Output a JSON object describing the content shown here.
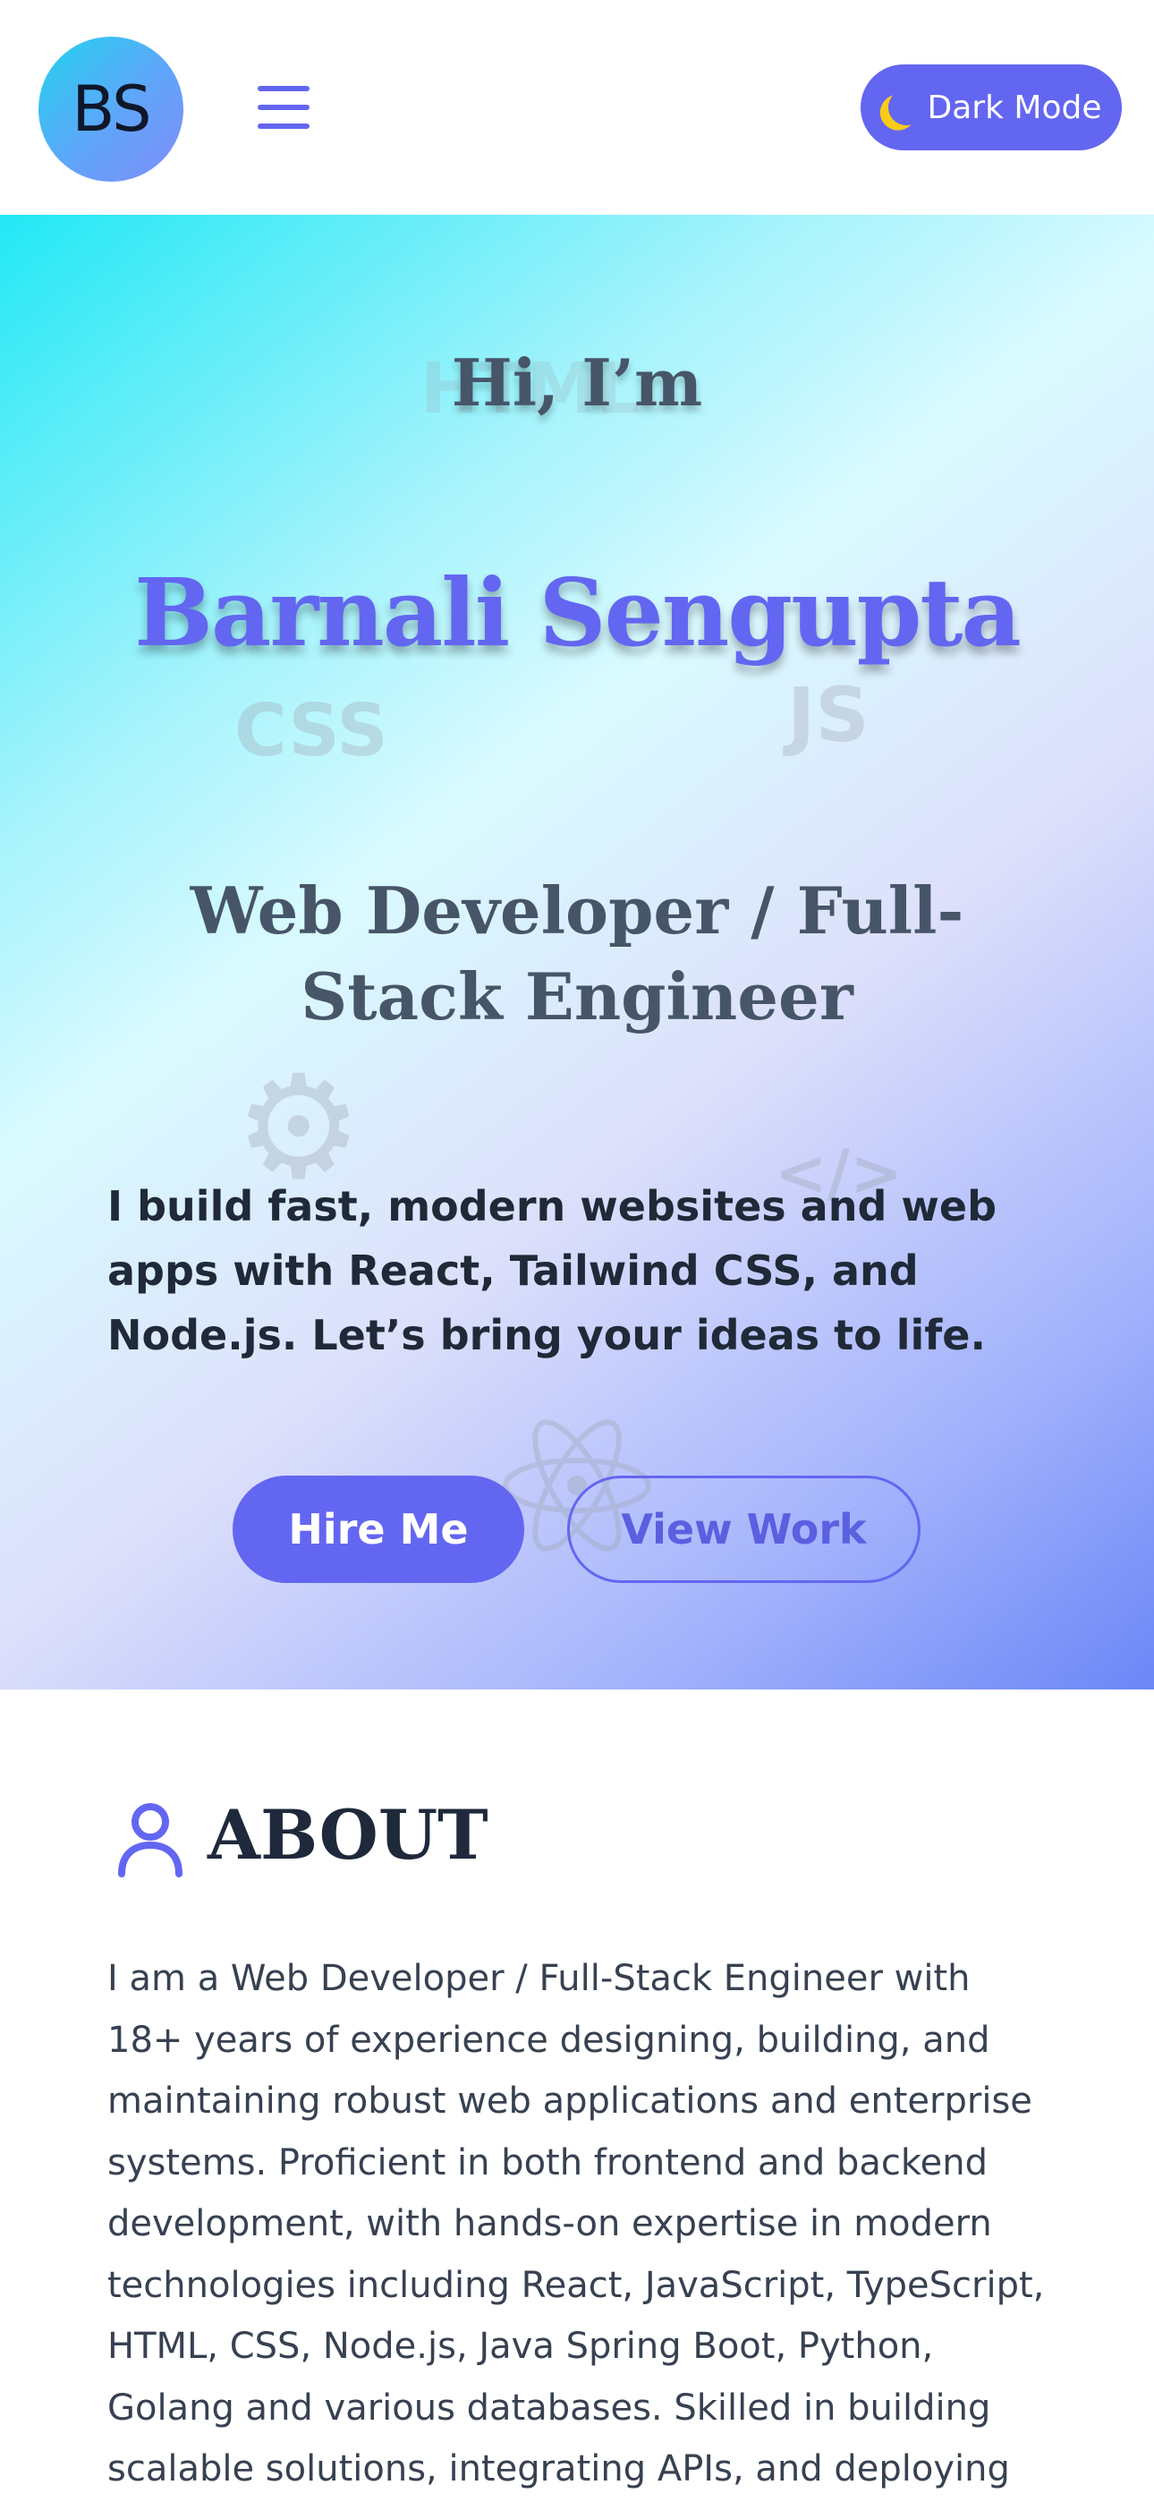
{
  "header": {
    "logo_initials": "BS",
    "menu_icon": "hamburger-menu-icon",
    "theme_toggle": {
      "icon": "moon-icon",
      "label": "Dark Mode"
    }
  },
  "hero": {
    "greeting": "Hi, I’m",
    "name": "Barnali Sengupta",
    "role": "Web Developer / Full-Stack Engineer",
    "description": "I build fast, modern websites and web apps with React, Tailwind CSS, and Node.js. Let’s bring your ideas to life.",
    "background_decorations": {
      "html": "HTML",
      "css": "CSS",
      "js": "JS",
      "gear": "⚙",
      "code": "</>"
    },
    "primary_button": "Hire Me",
    "secondary_button": "View Work"
  },
  "about": {
    "icon": "user-icon",
    "title": "ABOUT",
    "text": "I am a Web Developer / Full-Stack Engineer with 18+ years of experience designing, building, and maintaining robust web applications and enterprise systems. Proficient in both frontend and backend development, with hands-on expertise in modern technologies including React, JavaScript, TypeScript, HTML, CSS, Node.js, Java Spring Boot, Python, Golang and various databases. Skilled in building scalable solutions, integrating APIs, and deploying"
  },
  "colors": {
    "accent": "#6366f1",
    "heading": "#475569",
    "body_text": "#374151"
  }
}
